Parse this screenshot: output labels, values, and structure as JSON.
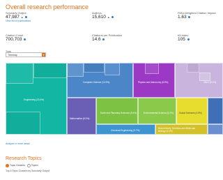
{
  "heading": "Overall research performance",
  "metrics": [
    {
      "label": "Scholarly Output",
      "value": "47,987",
      "trend_up": true
    },
    {
      "label": "Authors",
      "value": "15,610",
      "trend_up": true
    },
    {
      "label": "Field-Weighted Citation Impact",
      "value": "1.63"
    },
    {
      "label": "Citation Count",
      "value": "700,703"
    },
    {
      "label": "Citations per Publication",
      "value": "14.6"
    },
    {
      "label": "h5-index",
      "value": "105"
    }
  ],
  "view_publications_link": "View list of publications",
  "tabs_label": "Topic",
  "selector": {
    "value": "Treemap",
    "button": "▾"
  },
  "treemap_tiles": [
    {
      "label": "Engineering (23.4%)",
      "color": "#13b6a3"
    },
    {
      "label": "Computer Science (14.9%)",
      "color": "#4a86c8"
    },
    {
      "label": "Physics and Astronomy (8.5%)",
      "color": "#9b38c4"
    },
    {
      "label": "Other (6.2%)",
      "color": "#c8b4dd"
    },
    {
      "label": "Mathematics (6.0%)",
      "color": "#6b5fb5"
    },
    {
      "label": "Earth and Planetary Sciences (5.4%)",
      "color": "#7dc242"
    },
    {
      "label": "Environmental Science (5.2%)",
      "color": "#8bc94b"
    },
    {
      "label": "Social Sciences (4.5%)",
      "color": "#e6dd2f"
    },
    {
      "label": "Chemical Engineering (3.7%)",
      "color": "#3e94d1"
    },
    {
      "label": "Biochemistry, Genetics and Molecular Biology (3.4%)",
      "color": "#d2c12a"
    }
  ],
  "analyze_link": "Analyze in more detail",
  "section_title": "Research Topics",
  "radio_options": [
    {
      "label": "Topic Clusters",
      "selected": true
    },
    {
      "label": "Topics",
      "selected": false
    }
  ],
  "subheading": "Top 5 Topic Clusters by Scholarly Output"
}
